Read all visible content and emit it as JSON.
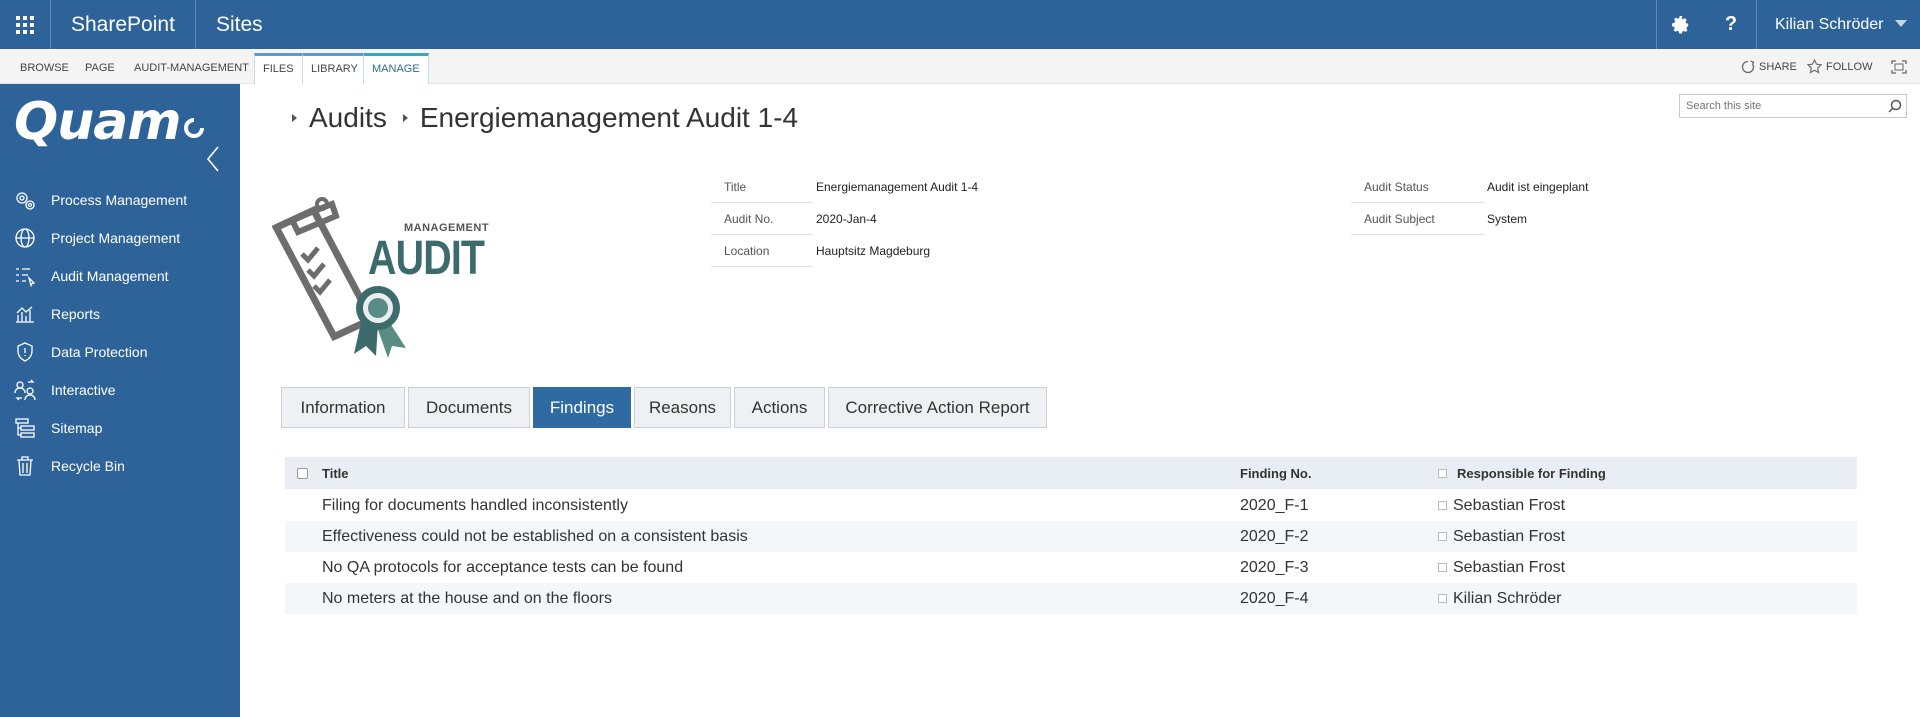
{
  "suitebar": {
    "brand": "SharePoint",
    "sites": "Sites",
    "user": "Kilian Schröder",
    "help": "?"
  },
  "ribbon": {
    "tabs": [
      "BROWSE",
      "PAGE",
      "AUDIT-MANAGEMENT",
      "FILES",
      "LIBRARY",
      "MANAGE"
    ],
    "share": "SHARE",
    "follow": "FOLLOW"
  },
  "leftnav": {
    "logo": "Quam",
    "items": [
      {
        "label": "Process Management",
        "icon": "gears-icon"
      },
      {
        "label": "Project Management",
        "icon": "globe-icon"
      },
      {
        "label": "Audit Management",
        "icon": "checklist-cursor-icon"
      },
      {
        "label": "Reports",
        "icon": "chart-icon"
      },
      {
        "label": "Data Protection",
        "icon": "shield-icon"
      },
      {
        "label": "Interactive",
        "icon": "people-exchange-icon"
      },
      {
        "label": "Sitemap",
        "icon": "sitemap-icon"
      },
      {
        "label": "Recycle Bin",
        "icon": "trash-icon"
      }
    ]
  },
  "search": {
    "placeholder": "Search this site"
  },
  "breadcrumb": {
    "parent": "Audits",
    "current": "Energiemanagement Audit 1-4"
  },
  "auditlogo": {
    "small": "MANAGEMENT",
    "big": "AUDIT"
  },
  "properties": {
    "left": [
      {
        "label": "Title",
        "value": "Energiemanagement Audit 1-4"
      },
      {
        "label": "Audit No.",
        "value": "2020-Jan-4"
      },
      {
        "label": "Location",
        "value": "Hauptsitz Magdeburg"
      }
    ],
    "right": [
      {
        "label": "Audit Status",
        "value": "Audit ist eingeplant"
      },
      {
        "label": "Audit Subject",
        "value": "System"
      }
    ]
  },
  "tabs": [
    {
      "label": "Information",
      "active": false
    },
    {
      "label": "Documents",
      "active": false
    },
    {
      "label": "Findings",
      "active": true
    },
    {
      "label": "Reasons",
      "active": false
    },
    {
      "label": "Actions",
      "active": false
    },
    {
      "label": "Corrective Action Report",
      "active": false
    }
  ],
  "table": {
    "columns": [
      "Title",
      "Finding No.",
      "Responsible for Finding"
    ],
    "rows": [
      {
        "title": "Filing for documents handled inconsistently",
        "no": "2020_F-1",
        "responsible": "Sebastian Frost"
      },
      {
        "title": "Effectiveness could not be established on a consistent basis",
        "no": "2020_F-2",
        "responsible": "Sebastian Frost"
      },
      {
        "title": "No QA protocols for acceptance tests can be found",
        "no": "2020_F-3",
        "responsible": "Sebastian Frost"
      },
      {
        "title": "No meters at the house and on the floors",
        "no": "2020_F-4",
        "responsible": "Kilian Schröder"
      }
    ]
  },
  "colors": {
    "suitebar": "#2e6399",
    "leftnav": "#2e6399",
    "active_tab": "#2f6aa3",
    "logo_teal": "#3d6b6b",
    "logo_gray": "#6d6d6d"
  }
}
